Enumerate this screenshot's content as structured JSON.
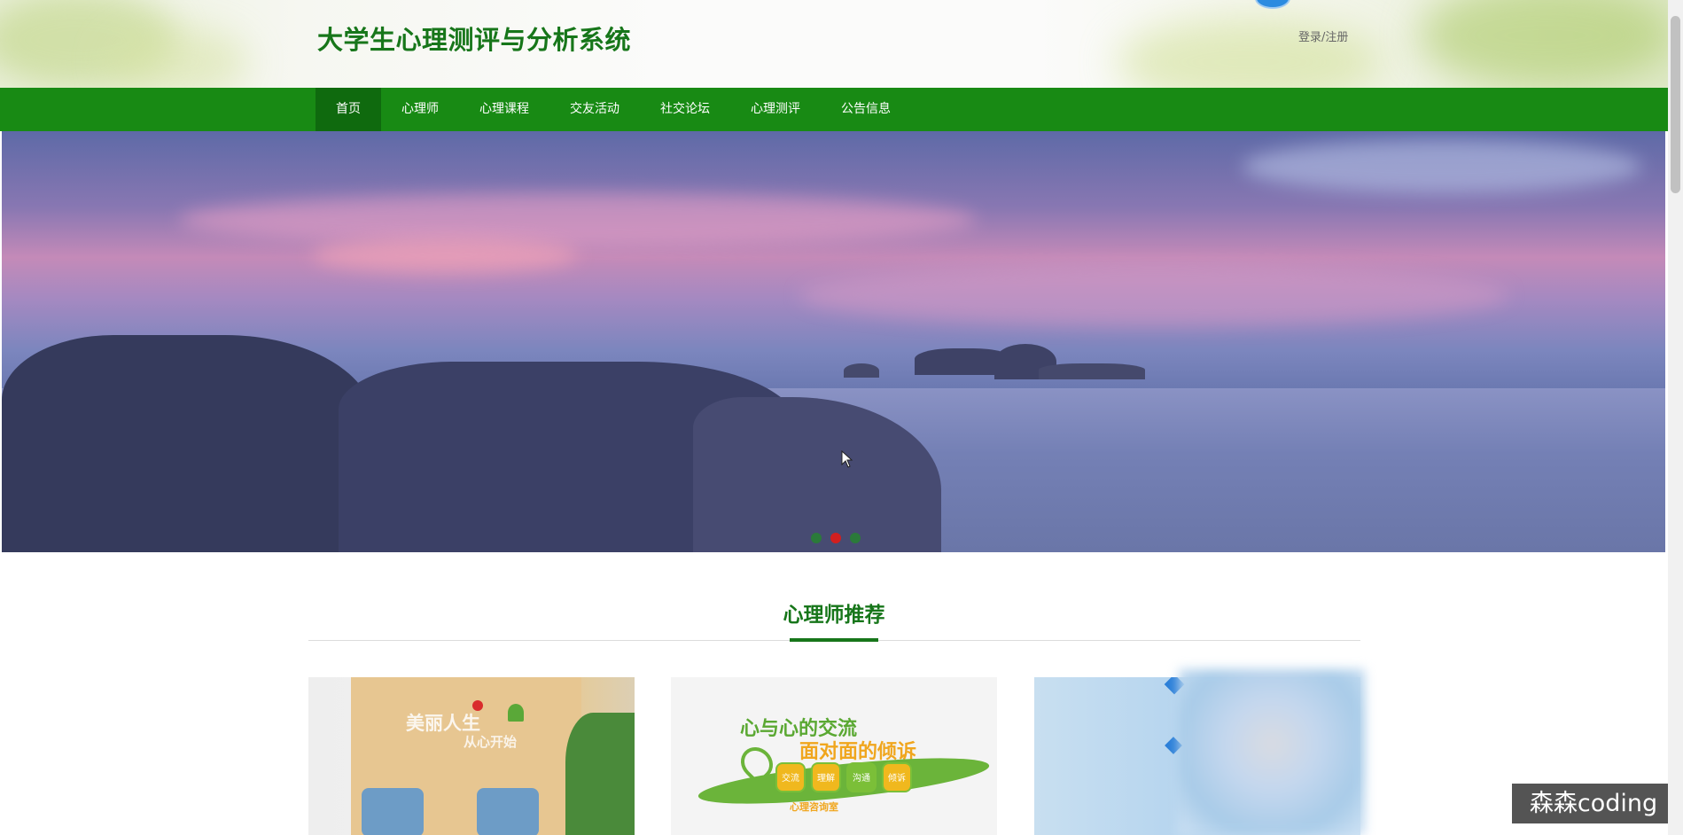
{
  "header": {
    "site_title": "大学生心理测评与分析系统",
    "login_label": "登录/注册"
  },
  "nav": {
    "items": [
      {
        "label": "首页",
        "active": true
      },
      {
        "label": "心理师"
      },
      {
        "label": "心理课程"
      },
      {
        "label": "交友活动"
      },
      {
        "label": "社交论坛"
      },
      {
        "label": "心理测评"
      },
      {
        "label": "公告信息"
      }
    ]
  },
  "banner": {
    "slide_count": 3,
    "active_slide": 2
  },
  "section": {
    "title": "心理师推荐"
  },
  "cards": {
    "card1_wall_text": "美丽人生",
    "card1_wall_sub": "从心开始",
    "card2_line1": "心与心的交流",
    "card2_line2": "面对面的倾诉",
    "card2_tags": [
      "交流",
      "理解",
      "沟通",
      "倾诉"
    ],
    "card2_footer": "心理咨询室"
  },
  "watermark": "森森coding",
  "colors": {
    "brand_green": "#188a14",
    "title_green": "#17761a",
    "active_nav": "#0f6a0e"
  }
}
